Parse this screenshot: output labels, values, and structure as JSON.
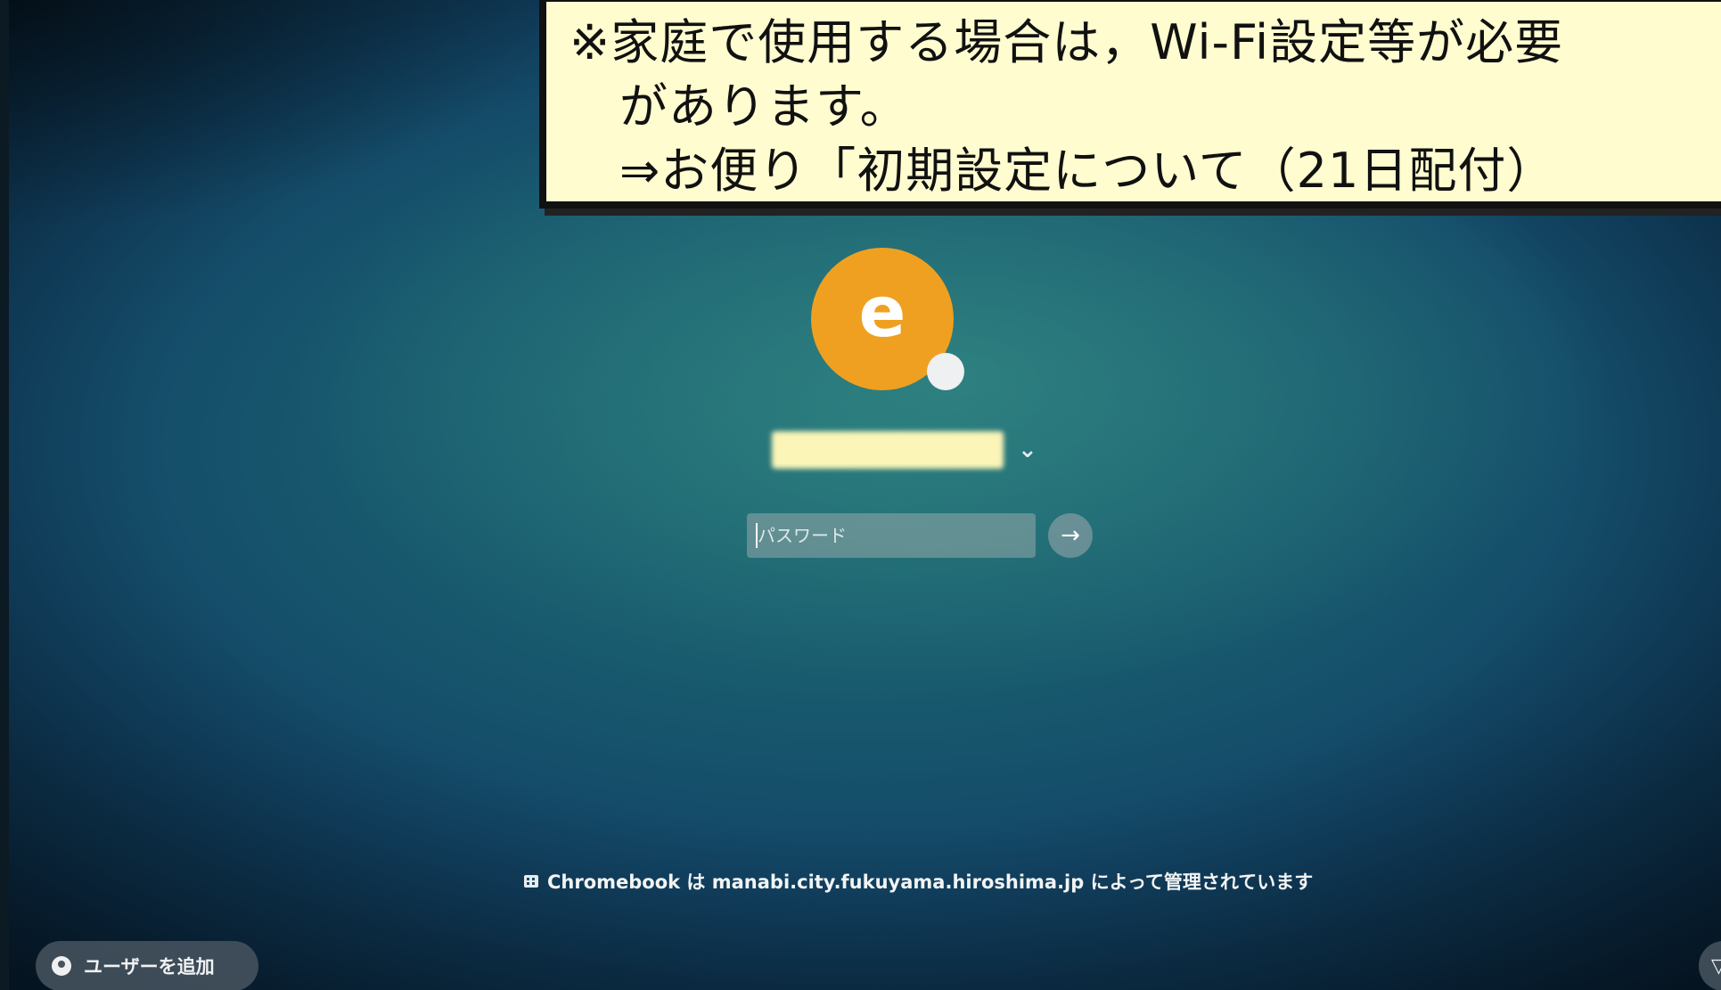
{
  "notice": {
    "line1": "※家庭で使用する場合は，Wi-Fi設定等が必要",
    "line2": "があります。",
    "line3": "⇒お便り「初期設定について（21日配付）"
  },
  "profile": {
    "avatar_letter": "e",
    "avatar_color": "#f0a020",
    "username": ""
  },
  "login": {
    "password_placeholder": "パスワード",
    "submit_icon": "→"
  },
  "footer": {
    "managed_text": "Chromebook は manabi.city.fukuyama.hiroshima.jp によって管理されています",
    "add_user_label": "ユーザーを追加"
  },
  "icons": {
    "chevron": "⌄",
    "wifi": "▽"
  }
}
